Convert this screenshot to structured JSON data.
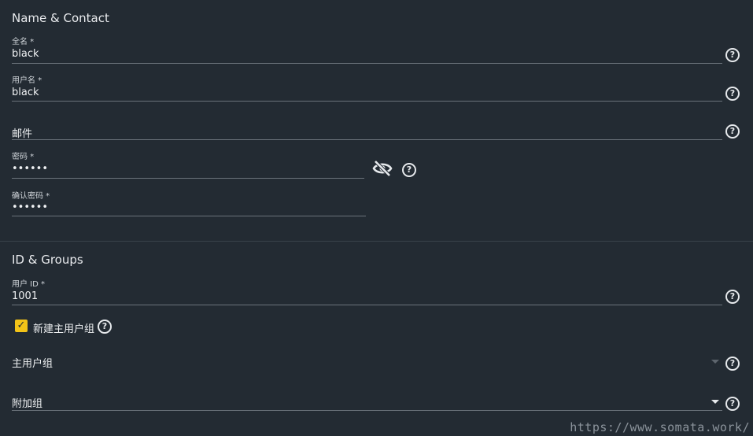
{
  "sections": {
    "name_contact": {
      "title": "Name & Contact",
      "full_name": {
        "label": "全名 *",
        "value": "black"
      },
      "username": {
        "label": "用户名 *",
        "value": "black"
      },
      "email": {
        "placeholder": "邮件",
        "value": ""
      },
      "password": {
        "label": "密码 *",
        "value": "••••••"
      },
      "confirm_password": {
        "label": "确认密码 *",
        "value": "••••••"
      }
    },
    "id_groups": {
      "title": "ID & Groups",
      "user_id": {
        "label": "用户 ID *",
        "value": "1001"
      },
      "create_primary_group": {
        "label": "新建主用户组",
        "checked": true
      },
      "primary_group": {
        "placeholder": "主用户组"
      },
      "aux_groups": {
        "placeholder": "附加组"
      }
    }
  },
  "icons": {
    "help": "?",
    "check": "✓",
    "eye_off": "eye-off-icon",
    "caret_down": "chevron-down-icon"
  },
  "colors": {
    "background": "#232b33",
    "accent": "#f2c318",
    "text": "#e6e9ec",
    "underline": "#6b737b"
  },
  "watermark": "https://www.somata.work/"
}
